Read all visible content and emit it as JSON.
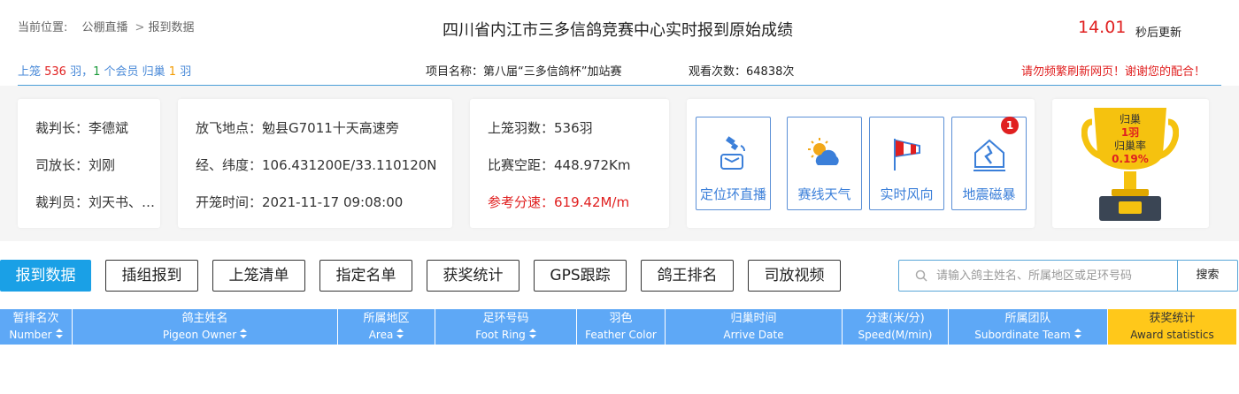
{
  "breadcrumb": {
    "prefix": "当前位置:",
    "item1": "公棚直播",
    "sep": ">",
    "item2": "报到数据"
  },
  "title": "四川省内江市三多信鸽竞赛中心实时报到原始成绩",
  "countdown": {
    "value": "14.01",
    "label": "秒后更新"
  },
  "stats": {
    "part1": "上笼 ",
    "loft_count": "536",
    "part2": " 羽，",
    "member_count": "1",
    "part3": " 个会员 归巢 ",
    "return_count": "1",
    "part4": " 羽"
  },
  "project": "项目名称：第八届“三多信鸽杯”加站赛",
  "views": "观看次数：64838次",
  "notice": "请勿频繁刷新网页！谢谢您的配合！",
  "card1": {
    "judge": "裁判长：李德斌",
    "releaser": "司放长：刘刚",
    "referee": "裁判员：刘天书、…"
  },
  "card2": {
    "location": "放飞地点：勉县G7011十天高速旁",
    "coords": "经、纬度：106.431200E/33.110120N",
    "time": "开笼时间：2021-11-17 09:08:00"
  },
  "card3": {
    "count": "上笼羽数：536羽",
    "distance": "比赛空距：448.972Km",
    "speed": "参考分速：619.42M/m"
  },
  "functions": [
    {
      "label": "定位环直播",
      "icon": "satellite-icon"
    },
    {
      "label": "赛线天气",
      "icon": "weather-icon"
    },
    {
      "label": "实时风向",
      "icon": "windsock-icon"
    },
    {
      "label": "地震磁暴",
      "icon": "earthquake-icon",
      "badge": "1"
    }
  ],
  "trophy": {
    "line1": "归巢",
    "line2": "1羽",
    "line3": "归巢率",
    "line4": "0.19%"
  },
  "tabs": [
    "报到数据",
    "插组报到",
    "上笼清单",
    "指定名单",
    "获奖统计",
    "GPS跟踪",
    "鸽王排名",
    "司放视频"
  ],
  "search": {
    "placeholder": "请输入鸽主姓名、所属地区或足环号码",
    "button": "搜索"
  },
  "table_headers": [
    {
      "cn": "暂排名次",
      "en": "Number",
      "sort": true
    },
    {
      "cn": "鸽主姓名",
      "en": "Pigeon Owner",
      "sort": true
    },
    {
      "cn": "所属地区",
      "en": "Area",
      "sort": true
    },
    {
      "cn": "足环号码",
      "en": "Foot Ring",
      "sort": true
    },
    {
      "cn": "羽色",
      "en": "Feather Color",
      "sort": false
    },
    {
      "cn": "归巢时间",
      "en": "Arrive Date",
      "sort": false
    },
    {
      "cn": "分速(米/分)",
      "en": "Speed(M/min)",
      "sort": false
    },
    {
      "cn": "所属团队",
      "en": "Subordinate Team",
      "sort": true
    },
    {
      "cn": "获奖统计",
      "en": "Award statistics",
      "sort": false
    }
  ],
  "colors": {
    "accent": "#1aa0e6",
    "header": "#5ea8f6",
    "gold": "#ffc81a",
    "red": "#e02020"
  }
}
